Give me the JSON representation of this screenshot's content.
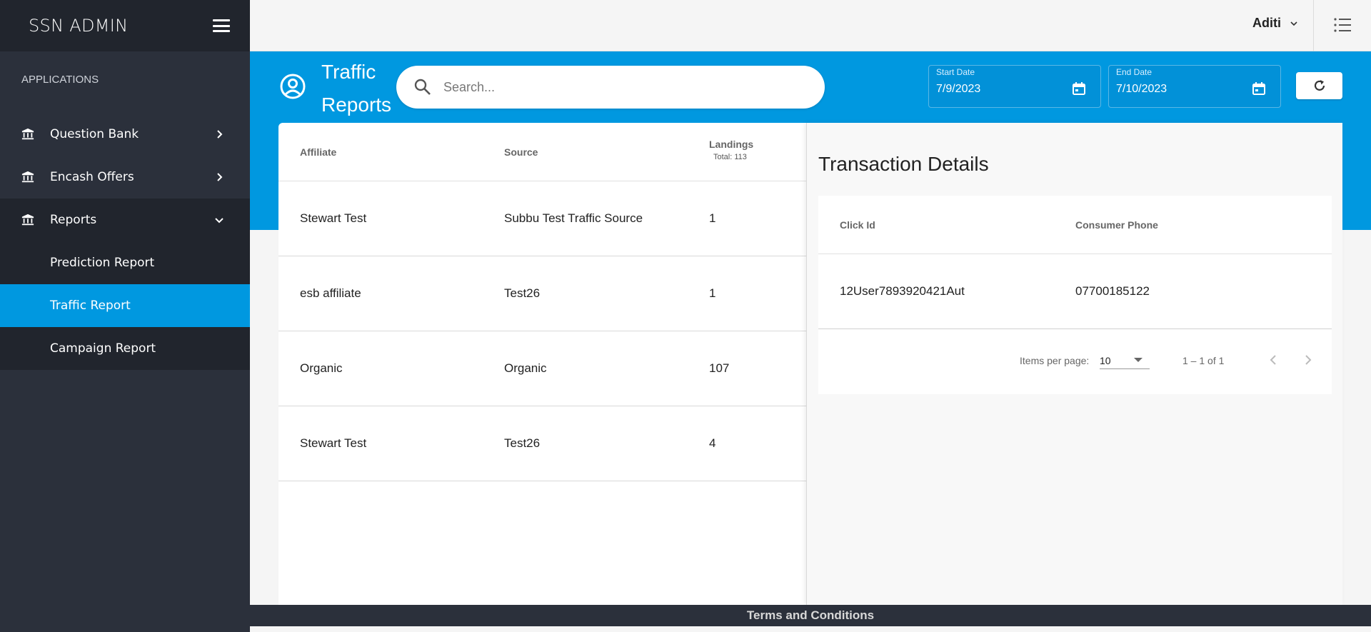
{
  "sidebar": {
    "brand": "SSN ADMIN",
    "section_label": "APPLICATIONS",
    "items": [
      {
        "label": "Question Bank",
        "icon": "bank-icon"
      },
      {
        "label": "Encash Offers",
        "icon": "bank-icon"
      },
      {
        "label": "Reports",
        "icon": "bank-icon",
        "expanded": true
      }
    ],
    "sub_items": [
      "Prediction Report",
      "Traffic Report",
      "Campaign Report"
    ],
    "active_sub_item": "Traffic Report"
  },
  "topbar": {
    "user_name": "Aditi"
  },
  "header": {
    "title": "Traffic Reports",
    "search_placeholder": "Search...",
    "start_date_label": "Start Date",
    "start_date": "7/9/2023",
    "end_date_label": "End Date",
    "end_date": "7/10/2023"
  },
  "table": {
    "columns": {
      "affiliate": "Affiliate",
      "source": "Source",
      "landings": "Landings",
      "landings_total": "Total: 113"
    },
    "rows": [
      {
        "affiliate": "Stewart Test",
        "source": "Subbu Test Traffic Source",
        "landings": "1"
      },
      {
        "affiliate": "esb affiliate",
        "source": "Test26",
        "landings": "1"
      },
      {
        "affiliate": "Organic",
        "source": "Organic",
        "landings": "107"
      },
      {
        "affiliate": "Stewart Test",
        "source": "Test26",
        "landings": "4"
      }
    ]
  },
  "details": {
    "title": "Transaction Details",
    "columns": {
      "click_id": "Click Id",
      "consumer_phone": "Consumer Phone"
    },
    "rows": [
      {
        "click_id": "12User7893920421Aut",
        "consumer_phone": "07700185122"
      }
    ],
    "pager": {
      "items_per_page_label": "Items per page:",
      "items_per_page": "10",
      "range": "1 – 1 of 1"
    }
  },
  "footer": {
    "link": "Terms and Conditions"
  },
  "colors": {
    "accent": "#0098e0",
    "sidebar": "#2b303b",
    "sidebar_dark": "#21252d"
  }
}
